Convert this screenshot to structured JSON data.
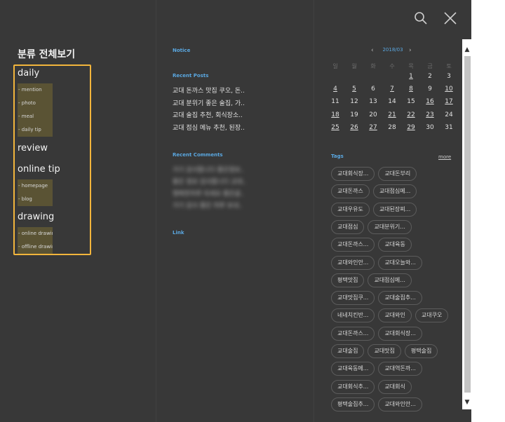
{
  "category": {
    "title": "분류 전체보기",
    "groups": [
      {
        "name": "daily",
        "items": [
          "- mention",
          "- photo",
          "- meal",
          "- daily tip"
        ]
      },
      {
        "name": "review",
        "items": []
      },
      {
        "name": "online tip",
        "items": [
          "- homepage",
          "- blog"
        ]
      },
      {
        "name": "drawing",
        "items": [
          "- online drawing",
          "- offline drawing"
        ]
      }
    ]
  },
  "notice": {
    "label": "Notice"
  },
  "recent_posts": {
    "label": "Recent Posts",
    "items": [
      "교대 돈까스 맛집 쿠오, 돈..",
      "교대 분위기 좋은 술집, 가..",
      "교대 술집 추천, 회식장소..",
      "교대 점심 메뉴 추천, 된장.."
    ]
  },
  "recent_comments": {
    "label": "Recent Comments",
    "items": [
      "가기 감사합니다 좋은정보..",
      "좋은 정보 감사합니다 교대..",
      "행복한하루 되세요 좋은글..",
      "가기 감사 좋은 하루 보내.."
    ]
  },
  "link": {
    "label": "Link"
  },
  "calendar": {
    "month": "2018/03",
    "prev": "‹",
    "next": "›",
    "weekdays": [
      "일",
      "월",
      "화",
      "수",
      "목",
      "금",
      "토"
    ],
    "weeks": [
      [
        "",
        "",
        "",
        "",
        "1",
        "2",
        "3"
      ],
      [
        "4",
        "5",
        "6",
        "7",
        "8",
        "9",
        "10"
      ],
      [
        "11",
        "12",
        "13",
        "14",
        "15",
        "16",
        "17"
      ],
      [
        "18",
        "19",
        "20",
        "21",
        "22",
        "23",
        "24"
      ],
      [
        "25",
        "26",
        "27",
        "28",
        "29",
        "30",
        "31"
      ]
    ],
    "linked_days": [
      "1",
      "4",
      "5",
      "7",
      "8",
      "10",
      "16",
      "17",
      "18",
      "21",
      "22",
      "23",
      "25",
      "26",
      "27",
      "29"
    ]
  },
  "tags": {
    "label": "Tags",
    "more": "more",
    "rows": [
      [
        "교대회식장...",
        "교대돈부리"
      ],
      [
        "교대돈까스",
        "교대점심메..."
      ],
      [
        "교대우유도",
        "교대된장찌..."
      ],
      [
        "교대점심",
        "교대분위기..."
      ],
      [
        "교대돈까스...",
        "교대육동"
      ],
      [
        "교대와인안...",
        "교대오늘와..."
      ],
      [
        "평택맛집",
        "교대점심메..."
      ],
      [
        "교대맛집쿠...",
        "교대술집추..."
      ],
      [
        "네네치킨반...",
        "교대와인",
        "교대쿠오"
      ],
      [
        "교대돈까스...",
        "교대회식장..."
      ],
      [
        "교대술집",
        "교대맛집",
        "평택술집"
      ],
      [
        "교대육동메...",
        "교대역돈까..."
      ],
      [
        "교대회식추...",
        "교대회식"
      ],
      [
        "평택술집추...",
        "교대와인안..."
      ]
    ]
  }
}
